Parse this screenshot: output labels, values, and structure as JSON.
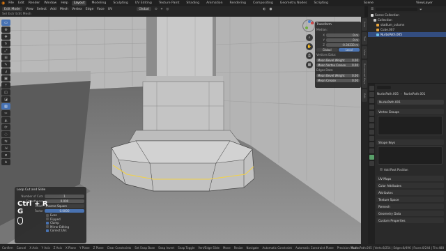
{
  "menu": [
    "File",
    "Edit",
    "Render",
    "Window",
    "Help"
  ],
  "workspaces": [
    "Layout",
    "Modeling",
    "Sculpting",
    "UV Editing",
    "Texture Paint",
    "Shading",
    "Animation",
    "Rendering",
    "Compositing",
    "Geometry Nodes",
    "Scripting"
  ],
  "active_workspace": "Layout",
  "scene_label": "Scene",
  "view_layer_label": "ViewLayer",
  "header": {
    "mode": "Edit Mode",
    "view": "View",
    "select": "Select",
    "add": "Add",
    "mesh": "Mesh",
    "vertex": "Vertex",
    "edge": "Edge",
    "face": "Face",
    "uv": "UV",
    "orientation": "Global"
  },
  "header3": {
    "text": "Sel   Extr   Edit   Mesh"
  },
  "toolbar_icons": [
    "select-icon",
    "cursor-icon",
    "move-icon",
    "rotate-icon",
    "scale-icon",
    "transform-icon",
    "annotate-icon",
    "measure-icon",
    "add-cube-icon",
    "extrude-icon",
    "inset-icon",
    "bevel-icon",
    "loopcut-icon",
    "knife-icon",
    "polybuild-icon",
    "spin-icon",
    "smooth-icon",
    "edge-slide-icon",
    "shrink-icon",
    "shear-icon",
    "rip-icon"
  ],
  "transform_panel": {
    "title": "Transform",
    "median_label": "Median:",
    "x": {
      "label": "X",
      "value": "0 m"
    },
    "y": {
      "label": "Y",
      "value": "0 m"
    },
    "z": {
      "label": "Z",
      "value": "-0.30233 m"
    },
    "global": "Global",
    "local": "Local",
    "vertices_data": "Vertices Data:",
    "mean_bevel_weight_v": {
      "label": "Mean Bevel Weight",
      "value": "0.00"
    },
    "mean_vertex_crease": {
      "label": "Mean Vertex Crease",
      "value": "0.00"
    },
    "edges_data": "Edges Data:",
    "mean_bevel_weight_e": {
      "label": "Mean Bevel Weight",
      "value": "0.00"
    },
    "mean_crease": {
      "label": "Mean Crease",
      "value": "0.00"
    }
  },
  "right_tabs": [
    "Item",
    "Tool",
    "View",
    "Screencast Keys",
    "Edit"
  ],
  "loopcut_panel": {
    "title": "Loop Cut and Slide",
    "cuts": {
      "label": "Number of Cuts",
      "value": "1"
    },
    "smoothness": {
      "label": "Smoothness",
      "value": "0.000"
    },
    "falloff": {
      "label": "Falloff",
      "value": "Inverse Square"
    },
    "factor": {
      "label": "Factor",
      "value": "0.0000"
    },
    "even": "Even",
    "flipped": "Flipped",
    "clamp": "Clamp",
    "mirror": "Mirror Editing",
    "correct_uvs": "Correct UVs"
  },
  "key_overlay": {
    "combo": "Ctrl + R",
    "key": "G"
  },
  "outliner": {
    "search_placeholder": "",
    "items": [
      {
        "name": "Scene Collection"
      },
      {
        "name": "Collection"
      },
      {
        "name": "stadium_column"
      },
      {
        "name": "Cube.007"
      },
      {
        "name": "NurbsPath.005"
      }
    ]
  },
  "properties": {
    "object_name": "NurbsPath.005",
    "data_name": "NurbsPath.001",
    "datablock": "NurbsPath.001",
    "vertex_groups": "Vertex Groups",
    "shape_keys": "Shape Keys",
    "add_rest_position": "Add Rest Position",
    "uv_maps": "UV Maps",
    "color_attributes": "Color Attributes",
    "attributes": "Attributes",
    "texture_space": "Texture Space",
    "remesh": "Remesh",
    "geometry_data": "Geometry Data",
    "custom_properties": "Custom Properties"
  },
  "status": {
    "items": [
      "Confirm",
      "Cancel",
      "X Axis",
      "Y Axis",
      "Z Axis",
      "X Plane",
      "Y Plane",
      "Z Plane",
      "Clear Constraints",
      "Set Snap Base",
      "Snap Invert",
      "Snap Toggle",
      "Vert/Edge Slide",
      "Move",
      "Resize",
      "Navigate",
      "Automatic Constraint",
      "Automatic Constraint Plane",
      "Precision Mode"
    ],
    "stats": "NurbsPath.005 | Verts:8/254 | Edges:8/496 | Faces:0/244 | Tris:488"
  },
  "colors": {
    "accent": "#4772b3",
    "selection": "#e8c74a",
    "active_green": "#5aa06a"
  }
}
